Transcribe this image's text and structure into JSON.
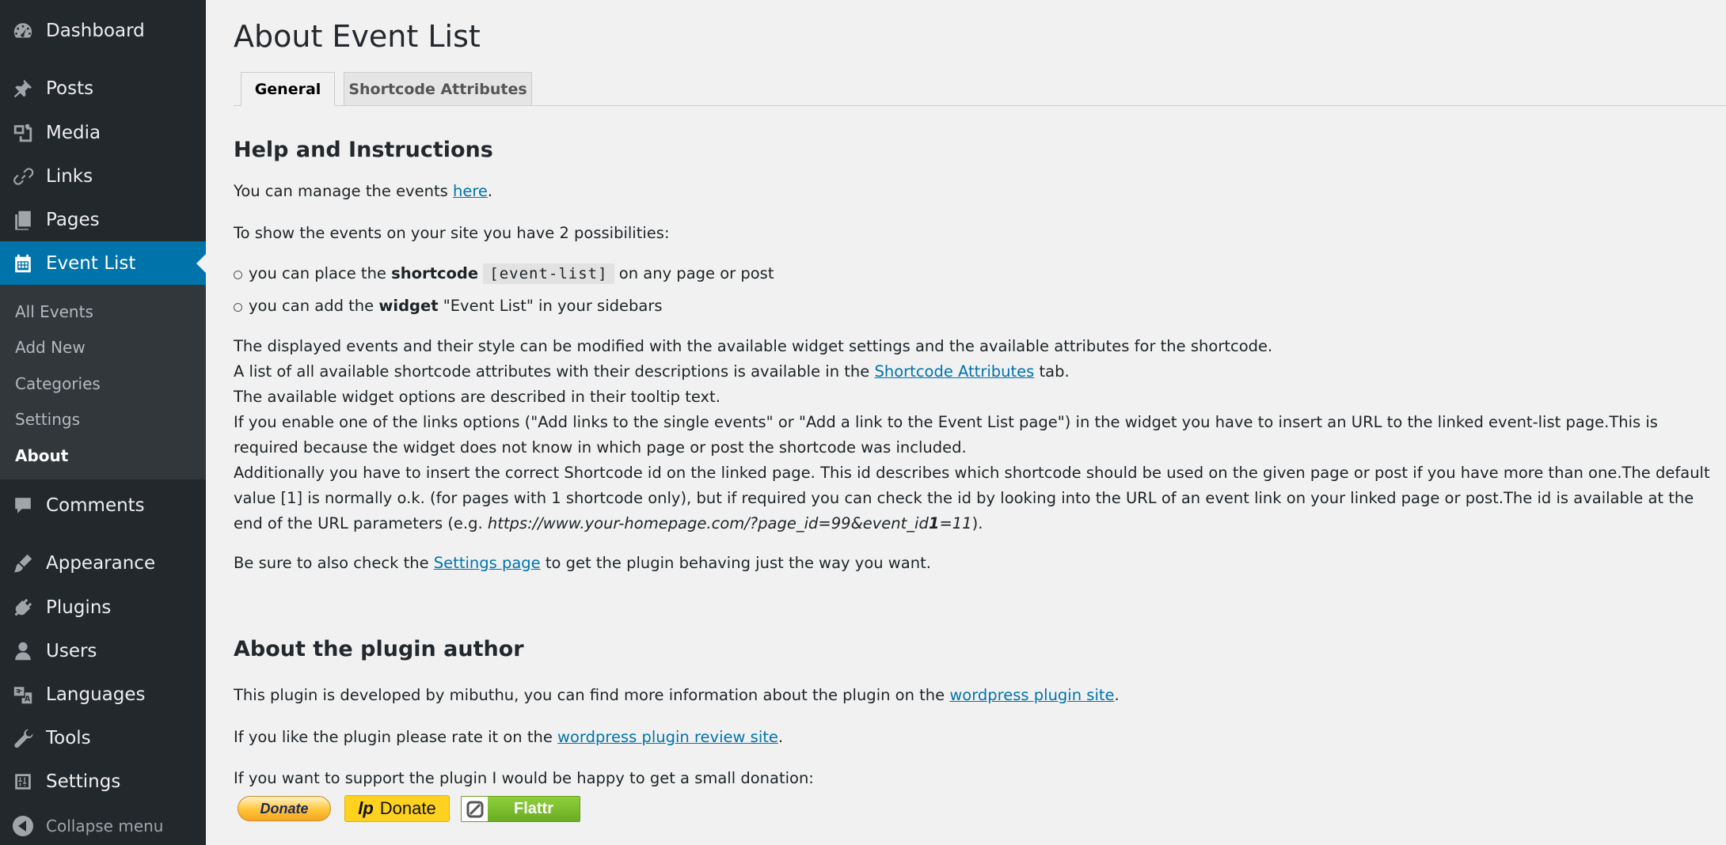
{
  "sidebar": {
    "items": [
      {
        "label": "Dashboard",
        "icon": "dashboard-icon"
      },
      {
        "label": "Posts",
        "icon": "pushpin-icon"
      },
      {
        "label": "Media",
        "icon": "media-icon"
      },
      {
        "label": "Links",
        "icon": "link-icon"
      },
      {
        "label": "Pages",
        "icon": "pages-icon"
      },
      {
        "label": "Event List",
        "icon": "calendar-icon"
      },
      {
        "label": "Comments",
        "icon": "comment-icon"
      },
      {
        "label": "Appearance",
        "icon": "brush-icon"
      },
      {
        "label": "Plugins",
        "icon": "plug-icon"
      },
      {
        "label": "Users",
        "icon": "user-icon"
      },
      {
        "label": "Languages",
        "icon": "translation-icon"
      },
      {
        "label": "Tools",
        "icon": "wrench-icon"
      },
      {
        "label": "Settings",
        "icon": "sliders-icon"
      }
    ],
    "submenu": [
      "All Events",
      "Add New",
      "Categories",
      "Settings",
      "About"
    ],
    "collapse_label": "Collapse menu",
    "accent_color": "#0073aa"
  },
  "page": {
    "title": "About Event List",
    "tabs": [
      "General",
      "Shortcode Attributes"
    ],
    "help": {
      "heading": "Help and Instructions",
      "manage_pre": "You can manage the events ",
      "manage_link": "here",
      "manage_post": ".",
      "possibilities": "To show the events on your site you have 2 possibilities:",
      "bullet1_pre": "you can place the ",
      "bullet1_bold": "shortcode",
      "bullet1_code": "[event-list]",
      "bullet1_post": " on any page or post",
      "bullet2_pre": "you can add the ",
      "bullet2_bold": "widget",
      "bullet2_post": " \"Event List\" in your sidebars",
      "para_line1": "The displayed events and their style can be modified with the available widget settings and the available attributes for the shortcode.",
      "para_line2_pre": "A list of all available shortcode attributes with their descriptions is available in the ",
      "para_line2_link": "Shortcode Attributes",
      "para_line2_post": " tab.",
      "para_line3": "The available widget options are described in their tooltip text.",
      "para_line4": "If you enable one of the links options (\"Add links to the single events\" or \"Add a link to the Event List page\") in the widget you have to insert an URL to the linked event-list page.This is required because the widget does not know in which page or post the shortcode was included.",
      "para_line5_pre": "Additionally you have to insert the correct Shortcode id on the linked page. This id describes which shortcode should be used on the given page or post if you have more than one.The default value [1] is normally o.k. (for pages with 1 shortcode only), but if required you can check the id by looking into the URL of an event link on your linked page or post.The id is available at the end of the URL parameters (e.g. ",
      "para_line5_url_a": "https://www.your-homepage.com/?page_id=99&event_id",
      "para_line5_url_b": "1",
      "para_line5_url_c": "=11",
      "para_line5_post": ").",
      "settings_pre": "Be sure to also check the ",
      "settings_link": "Settings page",
      "settings_post": " to get the plugin behaving just the way you want."
    },
    "author": {
      "heading": "About the plugin author",
      "dev_pre": "This plugin is developed by mibuthu, you can find more information about the plugin on the ",
      "dev_link": "wordpress plugin site",
      "dev_post": ".",
      "rate_pre": "If you like the plugin please rate it on the ",
      "rate_link": "wordpress plugin review site",
      "rate_post": ".",
      "donate_text": "If you want to support the plugin I would be happy to get a small donation:",
      "donate_paypal": "Donate",
      "donate_lp_logo": "lp",
      "donate_lp": "Donate",
      "donate_flattr": "Flattr"
    }
  }
}
